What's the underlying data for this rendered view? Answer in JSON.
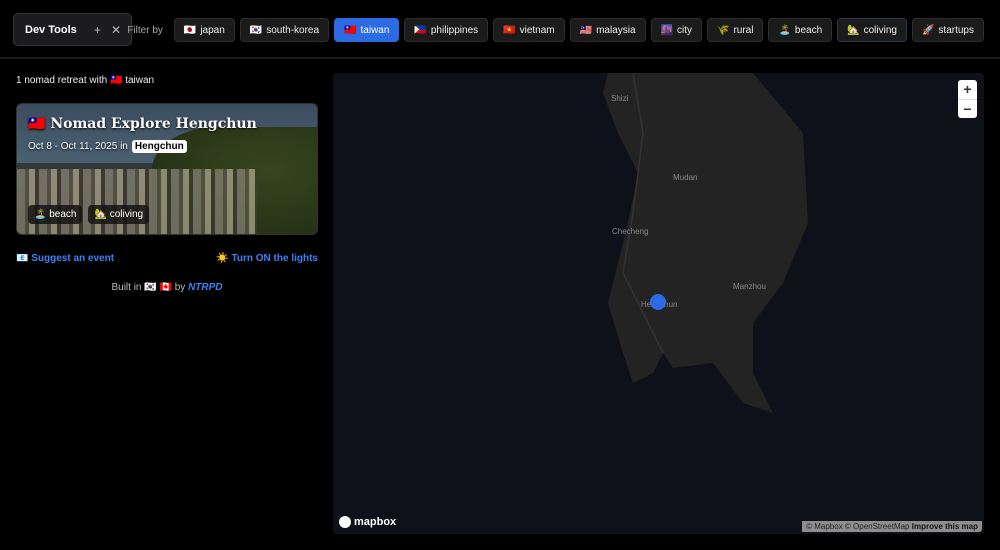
{
  "devtools": {
    "title": "Dev Tools",
    "add": "+",
    "close": "✕"
  },
  "filter": {
    "label": "Filter by",
    "chips": [
      {
        "icon": "🇯🇵",
        "label": "japan"
      },
      {
        "icon": "🇰🇷",
        "label": "south-korea"
      },
      {
        "icon": "🇹🇼",
        "label": "taiwan"
      },
      {
        "icon": "🇵🇭",
        "label": "philippines"
      },
      {
        "icon": "🇻🇳",
        "label": "vietnam"
      },
      {
        "icon": "🇲🇾",
        "label": "malaysia"
      },
      {
        "icon": "🌆",
        "label": "city"
      },
      {
        "icon": "🌾",
        "label": "rural"
      },
      {
        "icon": "🏝️",
        "label": "beach"
      },
      {
        "icon": "🏡",
        "label": "coliving"
      },
      {
        "icon": "🚀",
        "label": "startups"
      }
    ],
    "active": "taiwan"
  },
  "results": {
    "count_text": "1 nomad retreat with",
    "flag": "🇹🇼",
    "country": "taiwan"
  },
  "event": {
    "flag": "🇹🇼",
    "title": "Nomad Explore Hengchun",
    "dates": "Oct 8 - Oct 11, 2025 in",
    "city": "Hengchun",
    "tags": [
      {
        "icon": "🏝️",
        "label": "beach"
      },
      {
        "icon": "🏡",
        "label": "coliving"
      }
    ]
  },
  "links": {
    "suggest_icon": "📧",
    "suggest": "Suggest an event",
    "lights_icon": "☀️",
    "lights": "Turn ON the lights"
  },
  "footer": {
    "built": "Built in",
    "flags": "🇰🇷 🇨🇦",
    "by": "by",
    "author": "NTRPD"
  },
  "map": {
    "places": [
      "Shizi",
      "Mudan",
      "Checheng",
      "Hengchun",
      "Manzhou"
    ],
    "zoom_in": "+",
    "zoom_out": "−",
    "logo": "mapbox",
    "attribution": "© Mapbox © OpenStreetMap",
    "improve": "Improve this map"
  }
}
